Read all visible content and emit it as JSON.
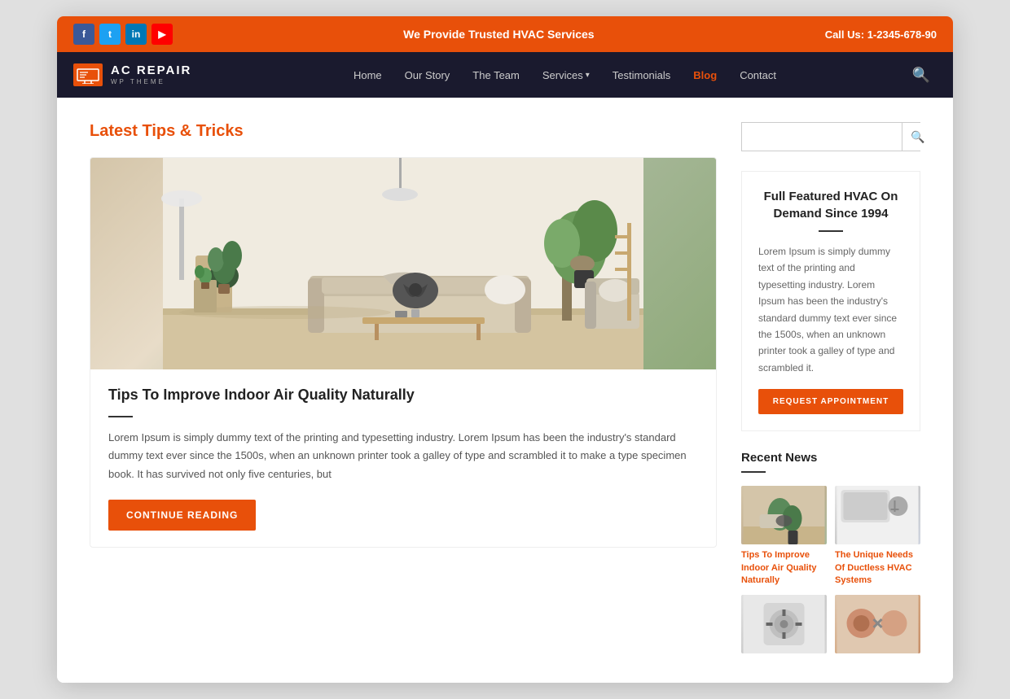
{
  "topBar": {
    "tagline": "We Provide Trusted HVAC Services",
    "phone": "Call Us: 1-2345-678-90",
    "socialIcons": [
      {
        "name": "facebook",
        "label": "f"
      },
      {
        "name": "twitter",
        "label": "t"
      },
      {
        "name": "linkedin",
        "label": "in"
      },
      {
        "name": "youtube",
        "label": "▶"
      }
    ]
  },
  "logo": {
    "main": "AC REPAIR",
    "sub": "WP THEME"
  },
  "nav": {
    "links": [
      {
        "label": "Home",
        "active": false
      },
      {
        "label": "Our Story",
        "active": false
      },
      {
        "label": "The Team",
        "active": false
      },
      {
        "label": "Services",
        "active": false,
        "hasDropdown": true
      },
      {
        "label": "Testimonials",
        "active": false
      },
      {
        "label": "Blog",
        "active": true
      },
      {
        "label": "Contact",
        "active": false
      }
    ]
  },
  "main": {
    "sectionTitle": "Latest Tips & Tricks",
    "article": {
      "title": "Tips To Improve Indoor Air Quality Naturally",
      "excerpt": "Lorem Ipsum is simply dummy text of the printing and typesetting industry. Lorem Ipsum has been the industry's standard dummy text ever since the 1500s, when an unknown printer took a galley of type and scrambled it to make a type specimen book. It has survived not only five centuries, but",
      "continueBtn": "CONTINUE READING"
    }
  },
  "sidebar": {
    "searchPlaceholder": "",
    "widget": {
      "title": "Full Featured HVAC On Demand Since 1994",
      "text": "Lorem Ipsum is simply dummy text of the printing and typesetting industry. Lorem Ipsum has been the industry's standard dummy text ever since the 1500s, when an unknown printer took a galley of type and scrambled it.",
      "btnLabel": "REQUEST APPOINTMENT"
    },
    "recentNews": {
      "title": "Recent News",
      "items": [
        {
          "title": "Tips To Improve Indoor Air Quality Naturally",
          "thumb": "room"
        },
        {
          "title": "The Unique Needs Of Ductless HVAC Systems",
          "thumb": "ac"
        },
        {
          "title": "",
          "thumb": "thermostat"
        },
        {
          "title": "",
          "thumb": "pipes"
        }
      ]
    }
  }
}
